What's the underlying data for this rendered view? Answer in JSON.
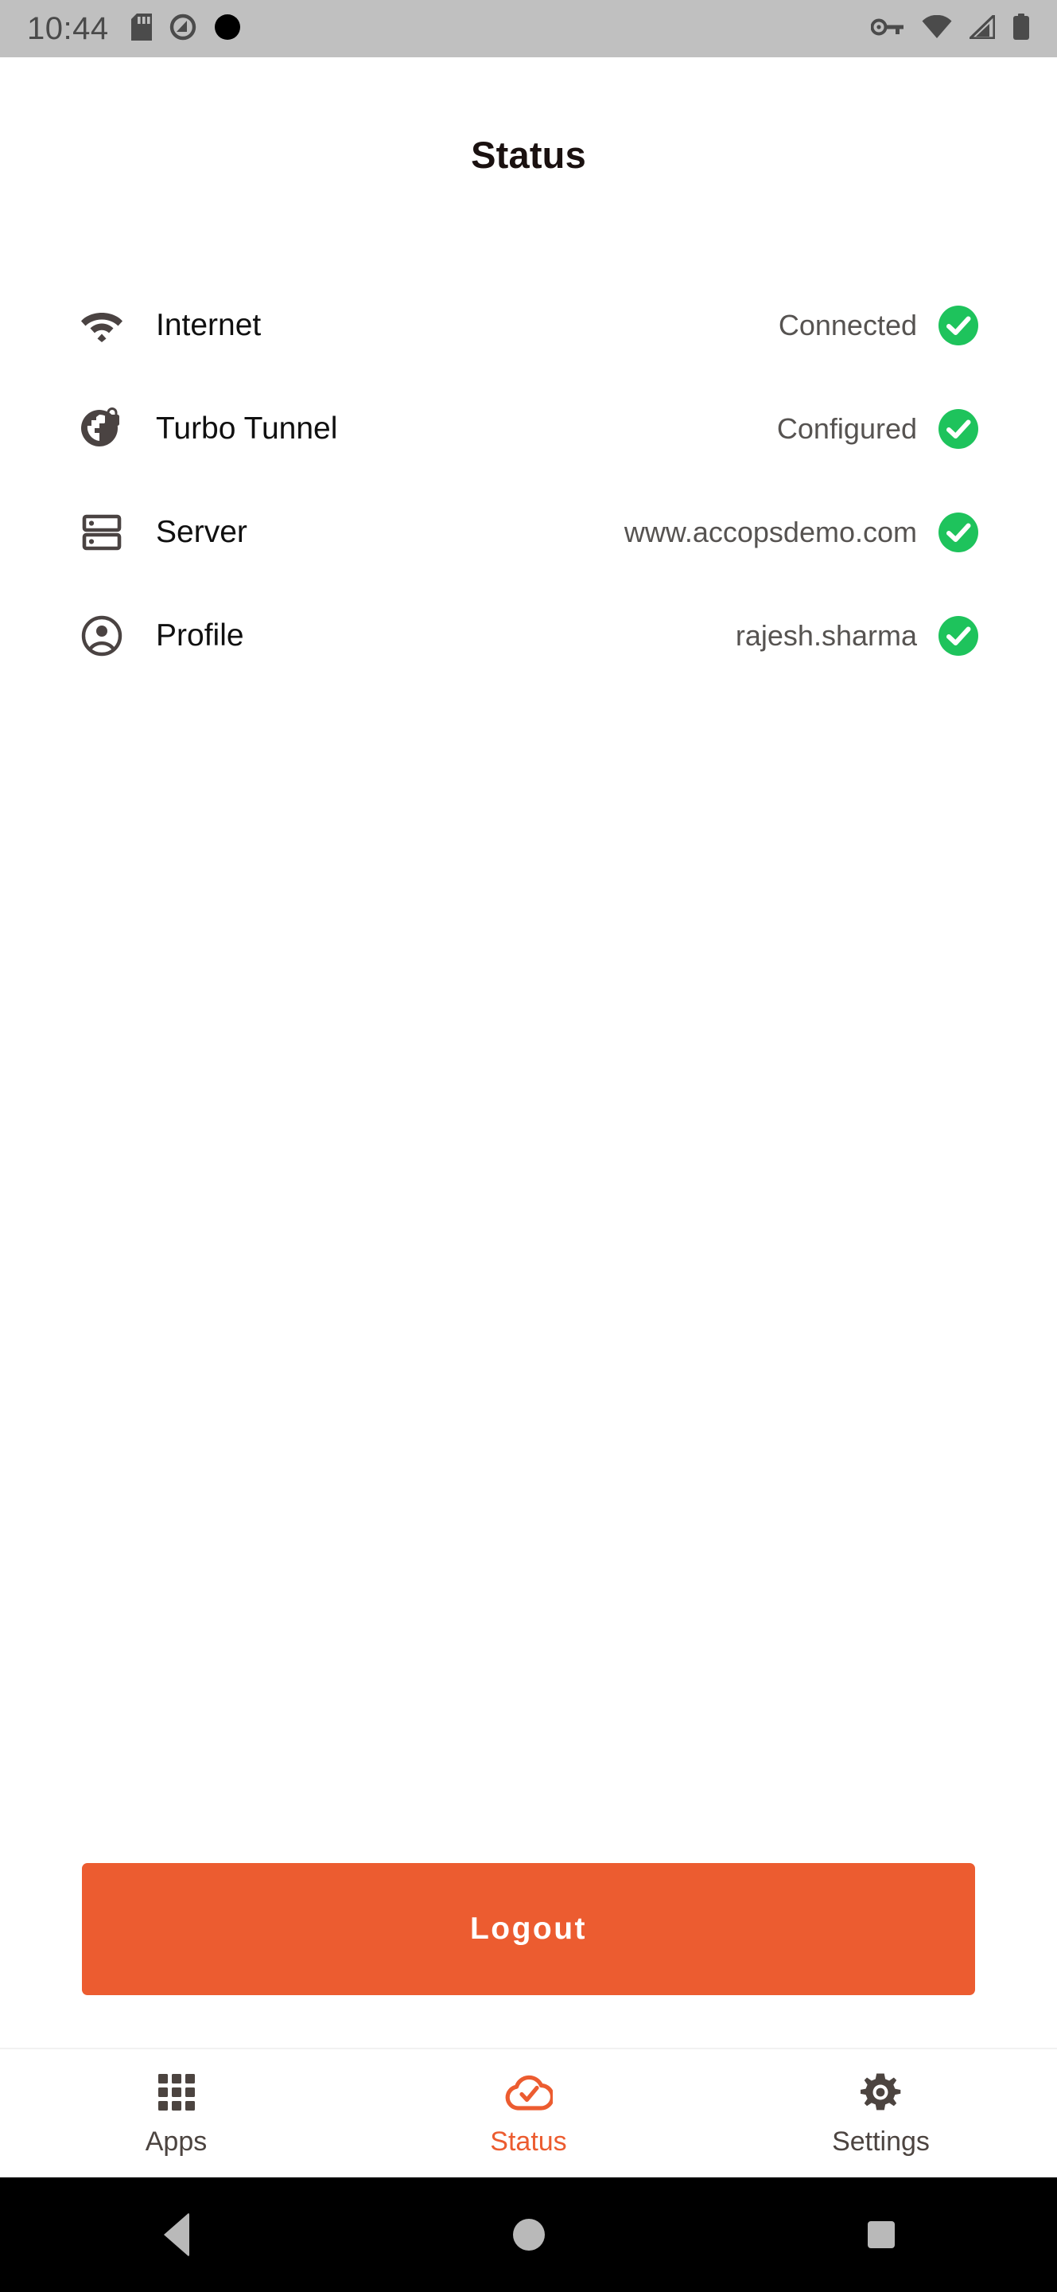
{
  "statusbar": {
    "time": "10:44",
    "left_icons": [
      "sd-card-icon",
      "android-q-logo-icon",
      "black-dot-icon"
    ],
    "right_icons": [
      "vpn-key-icon",
      "wifi-icon",
      "cellular-signal-icon",
      "battery-icon"
    ]
  },
  "header": {
    "title": "Status"
  },
  "status_list": [
    {
      "icon": "wifi-icon",
      "label": "Internet",
      "value": "Connected",
      "state": "ok"
    },
    {
      "icon": "globe-lock-icon",
      "label": "Turbo Tunnel",
      "value": "Configured",
      "state": "ok"
    },
    {
      "icon": "server-icon",
      "label": "Server",
      "value": "www.accopsdemo.com",
      "state": "ok"
    },
    {
      "icon": "account-icon",
      "label": "Profile",
      "value": "rajesh.sharma",
      "state": "ok"
    }
  ],
  "actions": {
    "logout_label": "Logout"
  },
  "bottom_nav": {
    "items": [
      {
        "icon": "apps-grid-icon",
        "label": "Apps",
        "active": false
      },
      {
        "icon": "cloud-check-icon",
        "label": "Status",
        "active": true
      },
      {
        "icon": "gear-icon",
        "label": "Settings",
        "active": false
      }
    ]
  },
  "android_nav": {
    "back": "back-button",
    "home": "home-button",
    "recents": "recents-button"
  },
  "colors": {
    "accent_orange": "#ec5c30",
    "status_green": "#1ec35c",
    "icon_gray": "#4a4342",
    "value_gray": "#565351",
    "statusbar_gray": "#c0c0c0"
  }
}
